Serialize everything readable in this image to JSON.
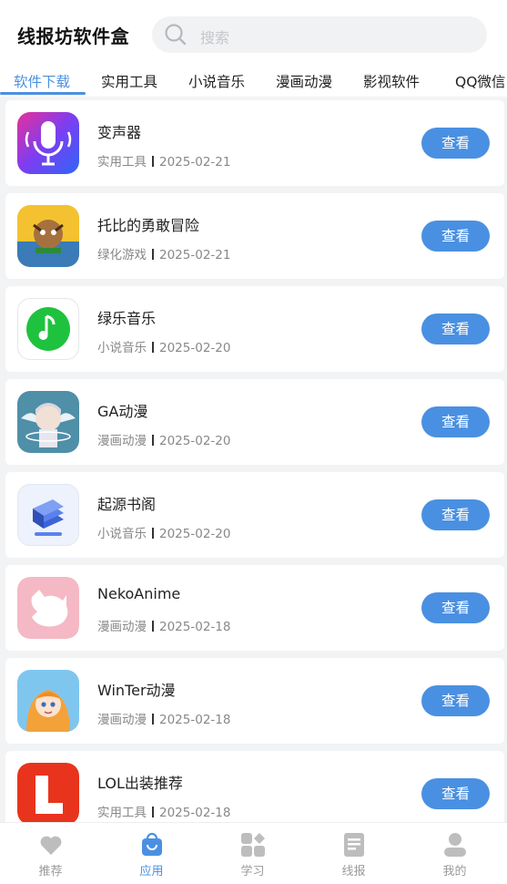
{
  "header": {
    "title": "线报坊软件盒",
    "search_placeholder": "搜索"
  },
  "tabs": [
    {
      "label": "软件下载",
      "active": true
    },
    {
      "label": "实用工具"
    },
    {
      "label": "小说音乐"
    },
    {
      "label": "漫画动漫"
    },
    {
      "label": "影视软件"
    },
    {
      "label": "QQ微信"
    }
  ],
  "items": [
    {
      "name": "变声器",
      "category": "实用工具",
      "date": "2025-02-21",
      "action": "查看",
      "icon": "microphone-icon"
    },
    {
      "name": "托比的勇敢冒险",
      "category": "绿化游戏",
      "date": "2025-02-21",
      "action": "查看",
      "icon": "game-art-icon"
    },
    {
      "name": "绿乐音乐",
      "category": "小说音乐",
      "date": "2025-02-20",
      "action": "查看",
      "icon": "music-note-icon"
    },
    {
      "name": "GA动漫",
      "category": "漫画动漫",
      "date": "2025-02-20",
      "action": "查看",
      "icon": "anime-character-icon"
    },
    {
      "name": "起源书阁",
      "category": "小说音乐",
      "date": "2025-02-20",
      "action": "查看",
      "icon": "book-icon"
    },
    {
      "name": "NekoAnime",
      "category": "漫画动漫",
      "date": "2025-02-18",
      "action": "查看",
      "icon": "cat-icon"
    },
    {
      "name": "WinTer动漫",
      "category": "漫画动漫",
      "date": "2025-02-18",
      "action": "查看",
      "icon": "anime-girl-icon"
    },
    {
      "name": "LOL出装推荐",
      "category": "实用工具",
      "date": "2025-02-18",
      "action": "查看",
      "icon": "letter-l-icon"
    }
  ],
  "nav": [
    {
      "label": "推荐",
      "icon": "heart-icon"
    },
    {
      "label": "应用",
      "icon": "shopping-bag-icon",
      "active": true
    },
    {
      "label": "学习",
      "icon": "grid-icon"
    },
    {
      "label": "线报",
      "icon": "document-icon"
    },
    {
      "label": "我的",
      "icon": "user-icon"
    }
  ],
  "colors": {
    "accent": "#4a90e2",
    "background": "#f2f3f5"
  }
}
